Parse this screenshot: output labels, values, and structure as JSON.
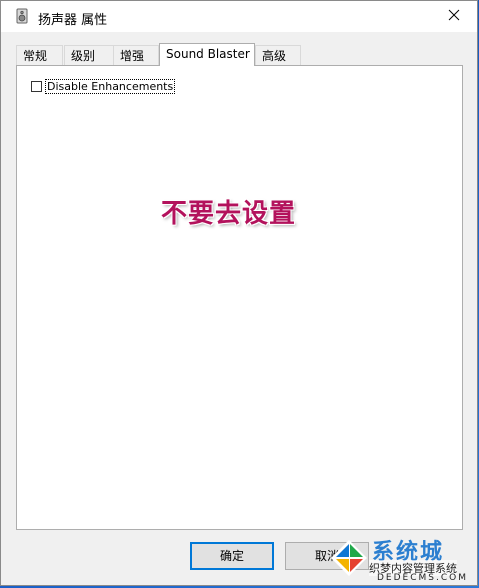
{
  "window": {
    "title": "扬声器 属性",
    "icon": "speaker-icon"
  },
  "tabs": [
    {
      "label": "常规",
      "active": false
    },
    {
      "label": "级别",
      "active": false
    },
    {
      "label": "增强",
      "active": false
    },
    {
      "label": "Sound Blaster",
      "active": true
    },
    {
      "label": "高级",
      "active": false
    }
  ],
  "panel": {
    "checkbox_label": "Disable Enhancements",
    "checkbox_checked": false,
    "annotation": "不要去设置"
  },
  "buttons": {
    "ok": "确定",
    "cancel": "取消"
  },
  "watermark": {
    "text1": "系统城",
    "text2": "织梦内容管理系统",
    "text3": "DEDECMS.COM"
  },
  "colors": {
    "annotation": "#b3125c",
    "accent": "#0078d7"
  }
}
